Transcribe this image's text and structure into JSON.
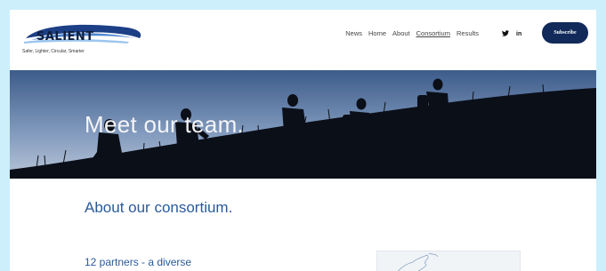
{
  "brand": {
    "name": "SALIENT",
    "tagline": "Safer, Lighter, Circular, Smarter"
  },
  "nav": {
    "items": [
      {
        "label": "News"
      },
      {
        "label": "Home"
      },
      {
        "label": "About"
      },
      {
        "label": "Consortium",
        "active": true
      },
      {
        "label": "Results"
      }
    ]
  },
  "social": {
    "twitter_icon": "twitter-icon",
    "linkedin_label": "in"
  },
  "subscribe_label": "Subscribe",
  "hero": {
    "title": "Meet our team."
  },
  "about": {
    "title": "About our consortium.",
    "partners_text": "12 partners - a diverse"
  },
  "colors": {
    "accent": "#112a5a",
    "heading_blue": "#2a5a9a",
    "page_background": "#cdeffb"
  }
}
